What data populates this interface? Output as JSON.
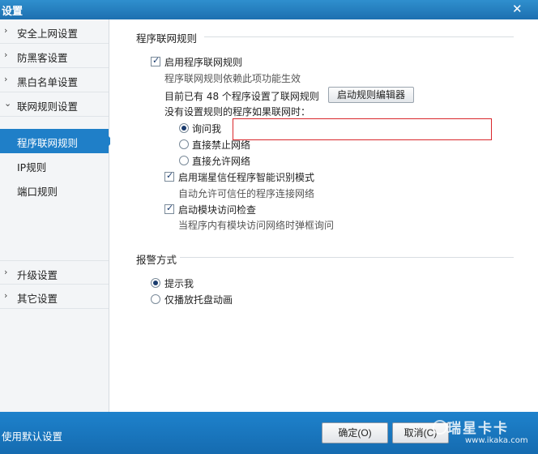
{
  "window": {
    "title": "设置",
    "close_glyph": "✕"
  },
  "sidebar": {
    "items": [
      {
        "label": "安全上网设置"
      },
      {
        "label": "防黑客设置"
      },
      {
        "label": "黑白名单设置"
      },
      {
        "label": "联网规则设置"
      }
    ],
    "sub_items": [
      {
        "label": "程序联网规则",
        "active": true
      },
      {
        "label": "IP规则",
        "active": false
      },
      {
        "label": "端口规则",
        "active": false
      }
    ],
    "bottom_items": [
      {
        "label": "升级设置"
      },
      {
        "label": "其它设置"
      }
    ]
  },
  "rules_section": {
    "title": "程序联网规则",
    "enable_label": "启用程序联网规则",
    "enable_checked": true,
    "enable_hint": "程序联网规则依赖此项功能生效",
    "count_text": "目前已有 48 个程序设置了联网规则",
    "editor_button": "启动规则编辑器",
    "unset_prompt": "没有设置规则的程序如果联网时：",
    "options": [
      {
        "label": "询问我",
        "selected": true
      },
      {
        "label": "直接禁止网络",
        "selected": false
      },
      {
        "label": "直接允许网络",
        "selected": false
      }
    ],
    "trust_label": "启用瑞星信任程序智能识别模式",
    "trust_checked": true,
    "trust_hint": "自动允许可信任的程序连接网络",
    "module_label": "启动模块访问检查",
    "module_checked": true,
    "module_hint": "当程序内有模块访问网络时弹框询问"
  },
  "alarm_section": {
    "title": "报警方式",
    "options": [
      {
        "label": "提示我",
        "selected": true
      },
      {
        "label": "仅播放托盘动画",
        "selected": false
      }
    ]
  },
  "footer": {
    "reset_label": "使用默认设置",
    "ok_label": "确定(O)",
    "cancel_label": "取消(C)",
    "watermark_logo": "瑞星卡卡",
    "watermark_url": "www.ikaka.com"
  },
  "colors": {
    "accent": "#1f7fc8",
    "titlebar": "#1d6fb0",
    "highlight_box": "#d9262b"
  }
}
